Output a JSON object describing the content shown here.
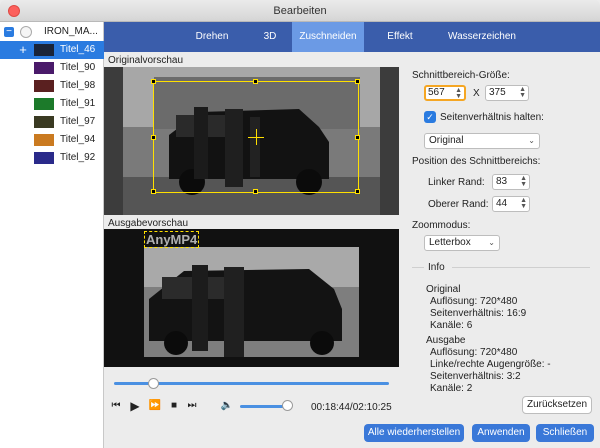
{
  "window": {
    "title": "Bearbeiten"
  },
  "sidebar": {
    "root_label": "IRON_MA...",
    "items": [
      {
        "label": "Titel_46",
        "selected": true,
        "thumb_color": "#1a2438"
      },
      {
        "label": "Titel_90",
        "thumb_color": "#4a1a6a"
      },
      {
        "label": "Titel_98",
        "thumb_color": "#5a2020"
      },
      {
        "label": "Titel_91",
        "thumb_color": "#1c7a2a"
      },
      {
        "label": "Titel_97",
        "thumb_color": "#3a3a22"
      },
      {
        "label": "Titel_94",
        "thumb_color": "#ca7a20"
      },
      {
        "label": "Titel_92",
        "thumb_color": "#2a2a8a"
      }
    ]
  },
  "tabs": [
    {
      "label": "Drehen"
    },
    {
      "label": "3D"
    },
    {
      "label": "Zuschneiden",
      "active": true
    },
    {
      "label": "Effekt"
    },
    {
      "label": "Wasserzeichen"
    }
  ],
  "preview": {
    "original_label": "Originalvorschau",
    "output_label": "Ausgabevorschau",
    "watermark_text": "AnyMP4"
  },
  "playback": {
    "time": "00:18:44/02:10:25",
    "seek_fraction": 0.14,
    "volume_fraction": 0.9,
    "icons": [
      "skip-back-icon",
      "play-icon",
      "fast-forward-icon",
      "stop-icon",
      "skip-forward-icon",
      "volume-icon"
    ]
  },
  "crop": {
    "size_label": "Schnittbereich-Größe:",
    "width": "567",
    "x_sep": "X",
    "height": "375",
    "keep_ratio_label": "Seitenverhältnis halten:",
    "ratio_option": "Original",
    "position_label": "Position des Schnittbereichs:",
    "left_margin_label": "Linker Rand:",
    "left_margin": "83",
    "top_margin_label": "Oberer Rand:",
    "top_margin": "44",
    "zoom_label": "Zoommodus:",
    "zoom_option": "Letterbox"
  },
  "info": {
    "title": "Info",
    "original_heading": "Original",
    "original_lines": [
      "Auflösung: 720*480",
      "Seitenverhältnis: 16:9",
      "Kanäle: 6"
    ],
    "output_heading": "Ausgabe",
    "output_lines": [
      "Auflösung: 720*480",
      "Linke/rechte Augengröße: -",
      "Seitenverhältnis: 3:2",
      "Kanäle: 2"
    ]
  },
  "buttons": {
    "reset": "Zurücksetzen",
    "restore_all": "Alle wiederherstellen",
    "apply": "Anwenden",
    "close": "Schließen"
  },
  "colors": {
    "accent": "#2a7be0",
    "tabbar": "#3a5dab",
    "tab_active": "#6b9ae5",
    "crop_frame": "#ffe000",
    "focus_ring": "#f5a623"
  }
}
